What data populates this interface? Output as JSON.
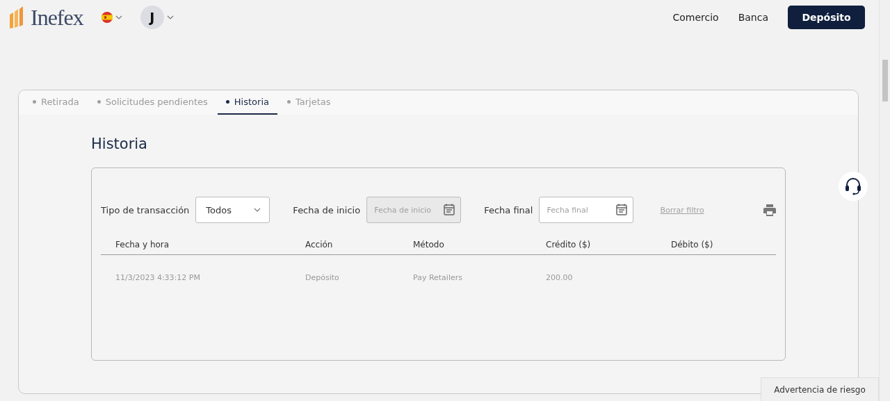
{
  "header": {
    "logo": "Inefex",
    "avatar": "J",
    "nav": [
      "Comercio",
      "Banca"
    ],
    "deposit_button": "Depósito"
  },
  "tabs": [
    {
      "label": "Retirada",
      "selected": false
    },
    {
      "label": "Solicitudes pendientes",
      "selected": false
    },
    {
      "label": "Historia",
      "selected": true
    },
    {
      "label": "Tarjetas",
      "selected": false
    }
  ],
  "title": "Historia",
  "filters": {
    "type_label": "Tipo de transacción",
    "type_value": "Todos",
    "start_label": "Fecha de inicio",
    "start_placeholder": "Fecha de inicio",
    "start_disabled": true,
    "end_label": "Fecha final",
    "end_placeholder": "Fecha final",
    "end_disabled": false,
    "clear": "Borrar filtro"
  },
  "table": {
    "columns": [
      "Fecha y hora",
      "Acción",
      "Método",
      "Crédito ($)",
      "Débito ($)"
    ],
    "rows": [
      [
        "11/3/2023 4:33:12 PM",
        "Depósito",
        "Pay Retailers",
        "200.00",
        ""
      ]
    ]
  },
  "risk_warning": "Advertencia de riesgo"
}
